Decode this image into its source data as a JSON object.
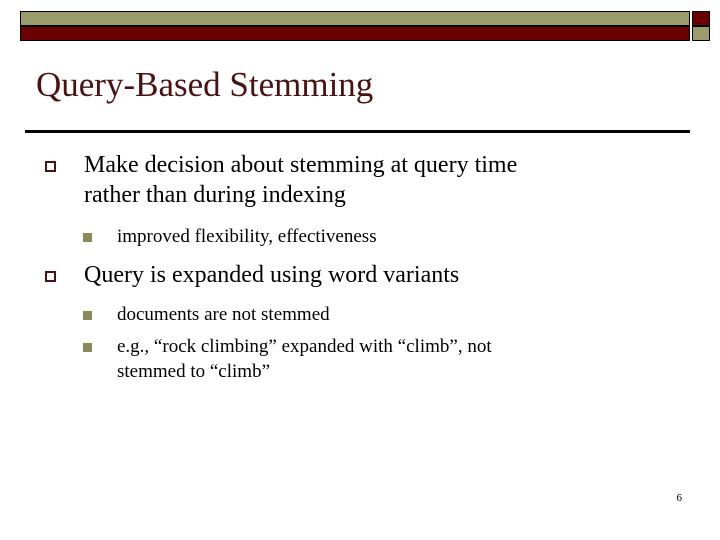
{
  "slide": {
    "title": "Query-Based Stemming",
    "page_number": "6",
    "colors": {
      "title": "#4a1212",
      "olive": "#9b9b6b",
      "maroon": "#6b0000",
      "sub_bullet": "#8a8a5c",
      "body_text": "#000000",
      "rule": "#000000",
      "background": "#ffffff"
    },
    "header": {
      "top_bar_color": "#9b9b6b",
      "top_square_color": "#6b0000",
      "bottom_bar_color": "#6b0000",
      "bottom_square_color": "#9b9b6b"
    },
    "content": [
      {
        "level": 1,
        "marker": "hollow-square",
        "lines": [
          "Make decision about stemming at query time",
          "rather than during indexing"
        ]
      },
      {
        "level": 2,
        "marker": "filled-square",
        "lines": [
          "improved flexibility, effectiveness"
        ]
      },
      {
        "level": 1,
        "marker": "hollow-square",
        "lines": [
          "Query is expanded using word variants"
        ]
      },
      {
        "level": 2,
        "marker": "filled-square",
        "lines": [
          "documents are not stemmed"
        ]
      },
      {
        "level": 2,
        "marker": "filled-square",
        "lines": [
          "e.g., “rock climbing” expanded with “climb”, not",
          "stemmed to “climb”"
        ]
      }
    ]
  }
}
